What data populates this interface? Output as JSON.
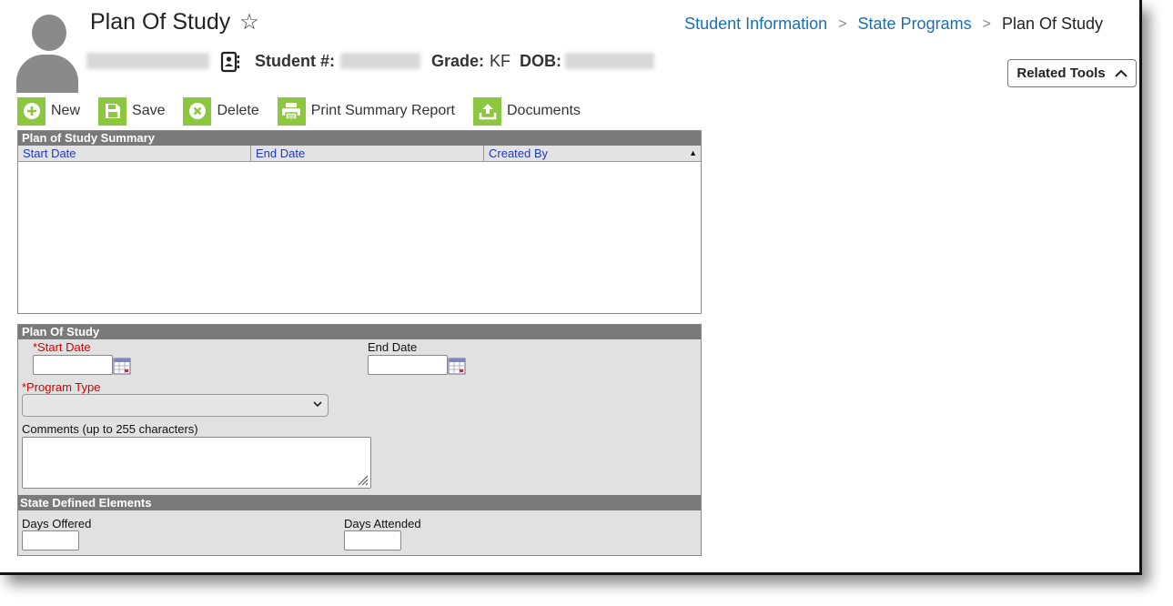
{
  "header": {
    "title": "Plan Of Study",
    "student_number_label": "Student #:",
    "grade_label": "Grade:",
    "grade_value": "KF",
    "dob_label": "DOB:"
  },
  "breadcrumb": {
    "items": [
      "Student Information",
      "State Programs"
    ],
    "current": "Plan Of Study"
  },
  "related_tools": {
    "label": "Related Tools"
  },
  "toolbar": {
    "new_label": "New",
    "save_label": "Save",
    "delete_label": "Delete",
    "print_label": "Print Summary Report",
    "documents_label": "Documents"
  },
  "summary": {
    "title": "Plan of Study Summary",
    "columns": [
      "Start Date",
      "End Date",
      "Created By"
    ],
    "rows": []
  },
  "detail": {
    "title": "Plan Of Study",
    "start_date_label": "*Start Date",
    "start_date_value": "",
    "end_date_label": "End Date",
    "end_date_value": "",
    "program_type_label": "*Program Type",
    "program_type_value": "",
    "comments_label": "Comments (up to 255 characters)",
    "comments_value": "",
    "state_section_title": "State Defined Elements",
    "days_offered_label": "Days Offered",
    "days_attended_label": "Days Attended"
  },
  "colors": {
    "accent_green": "#8dc63f",
    "link_blue": "#1a6fb3",
    "header_gray": "#7a7a7a",
    "required_red": "#d40000"
  }
}
